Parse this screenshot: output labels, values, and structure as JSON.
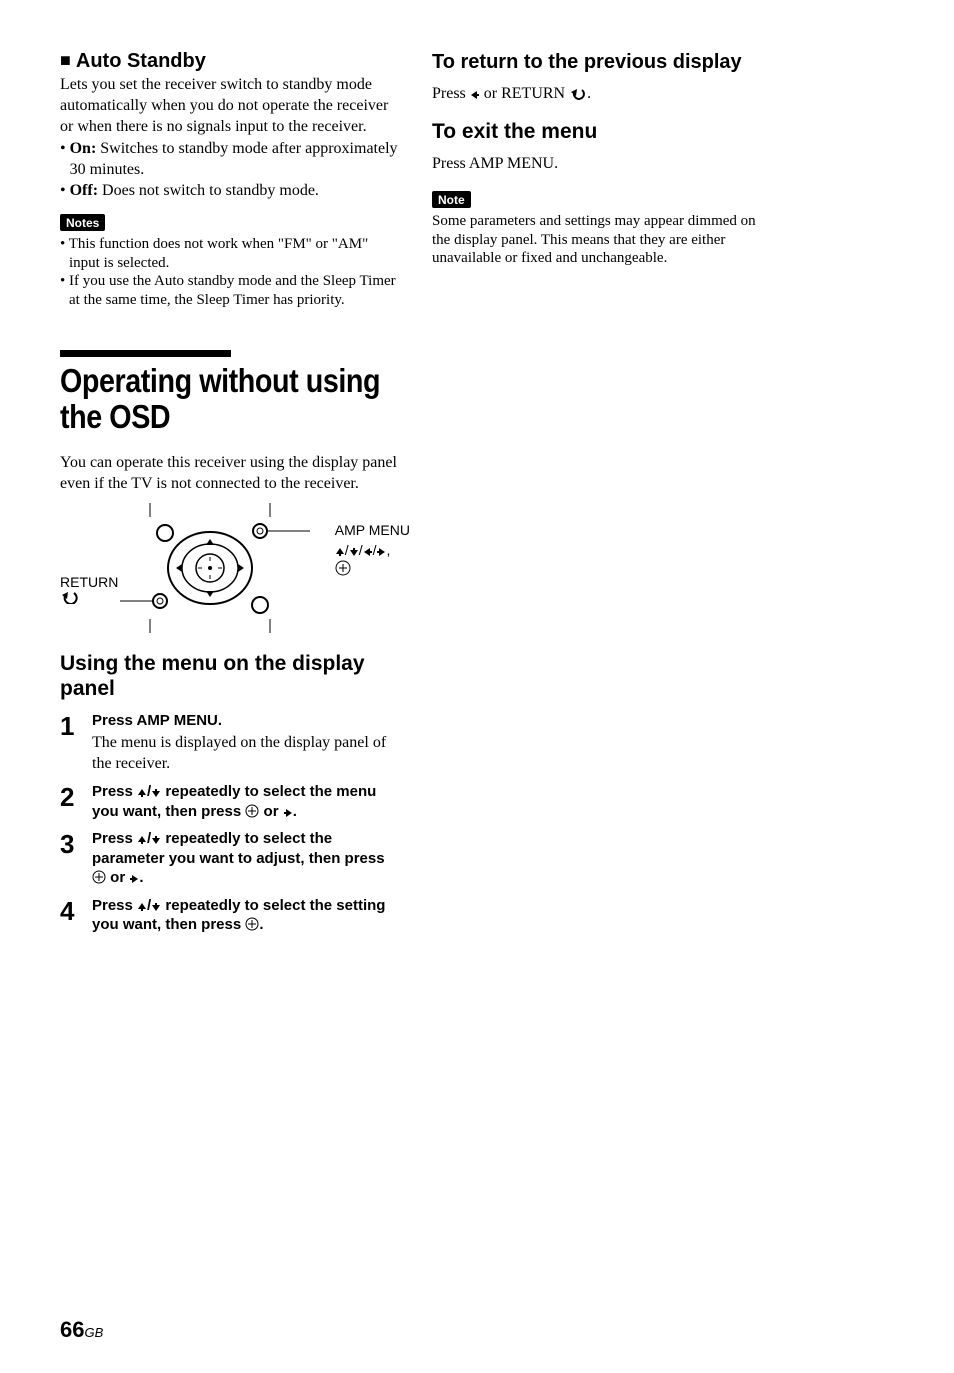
{
  "left": {
    "autoStandby": {
      "heading": "Auto Standby",
      "intro": "Lets you set the receiver switch to standby mode automatically when you do not operate the receiver or when there is no signals input to the receiver.",
      "bullets": [
        {
          "bold": "On:",
          "rest": " Switches to standby mode after approximately 30 minutes."
        },
        {
          "bold": "Off:",
          "rest": " Does not switch to standby mode."
        }
      ],
      "notesLabel": "Notes",
      "notes": [
        "This function does not work when \"FM\" or \"AM\" input is selected.",
        "If you use the Auto standby mode and the Sleep Timer at the same time, the Sleep Timer has priority."
      ]
    },
    "operating": {
      "heading": "Operating without using the OSD",
      "intro": "You can operate this receiver using the display panel even if the TV is not connected to the receiver.",
      "remoteLabels": {
        "left": "RETURN",
        "rightTop": "AMP MENU",
        "rightArrows": "✦/✦/✦/✦,"
      },
      "usingMenuHeading": "Using the menu on the display panel",
      "steps": [
        {
          "num": "1",
          "instr": "Press AMP MENU.",
          "desc": "The menu is displayed on the display panel of the receiver."
        },
        {
          "num": "2",
          "instrParts": [
            "Press ",
            "✦/✦",
            " repeatedly to select the menu you want, then press ",
            "⊕",
            " or ",
            "✦",
            "."
          ]
        },
        {
          "num": "3",
          "instrParts": [
            "Press ",
            "✦/✦",
            " repeatedly to select the parameter you want to adjust, then press ",
            "⊕",
            " or ",
            "✦",
            "."
          ]
        },
        {
          "num": "4",
          "instrParts": [
            "Press ",
            "✦/✦",
            " repeatedly to select the setting you want, then press ",
            "⊕",
            "."
          ]
        }
      ]
    }
  },
  "right": {
    "returnPrev": {
      "heading": "To return to the previous display",
      "bodyParts": [
        "Press ",
        "✦",
        " or RETURN ",
        "↺",
        "."
      ]
    },
    "exitMenu": {
      "heading": "To exit the menu",
      "body": "Press AMP MENU."
    },
    "note": {
      "label": "Note",
      "body": "Some parameters and settings may appear dimmed on the display panel. This means that they are either either unavailable or fixed and unchangeable."
    },
    "note_correct": {
      "label": "Note",
      "body": "Some parameters and settings may appear dimmed on the display panel. This means that they are either unavailable or fixed and unchangeable."
    }
  },
  "page": {
    "num": "66",
    "region": "GB"
  }
}
